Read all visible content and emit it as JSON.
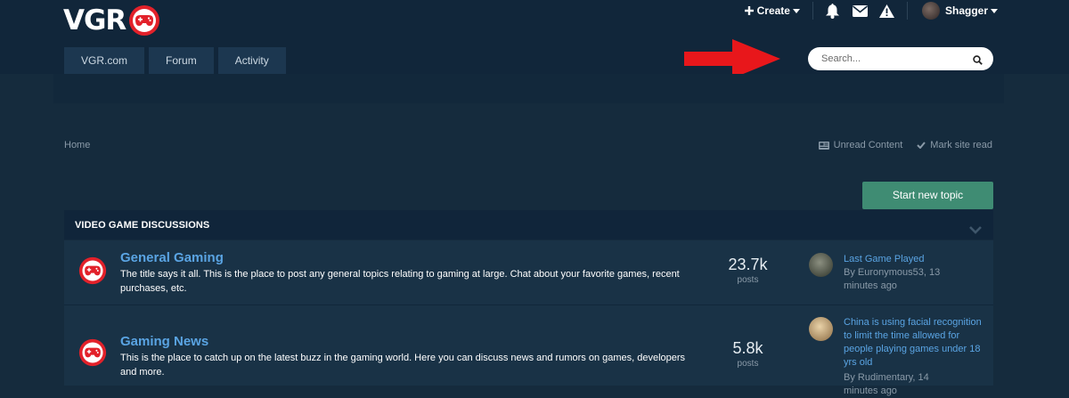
{
  "site": {
    "logo_text": "VGR"
  },
  "userbar": {
    "create_label": "Create",
    "username": "Shagger"
  },
  "nav": {
    "tabs": [
      {
        "label": "VGR.com"
      },
      {
        "label": "Forum"
      },
      {
        "label": "Activity"
      }
    ]
  },
  "search": {
    "placeholder": "Search..."
  },
  "breadcrumb": {
    "home": "Home"
  },
  "actions": {
    "unread_label": "Unread Content",
    "mark_read_label": "Mark site read"
  },
  "start_topic_label": "Start new topic",
  "category": {
    "title": "VIDEO GAME DISCUSSIONS",
    "forums": [
      {
        "title": "General Gaming",
        "description": "The title says it all. This is the place to post any general topics relating to gaming at large. Chat about your favorite games, recent purchases, etc.",
        "posts_count": "23.7k",
        "posts_label": "posts",
        "last_post": {
          "title": "Last Game Played",
          "meta": "By Euronymous53, 13 minutes ago"
        }
      },
      {
        "title": "Gaming News",
        "description": "This is the place to catch up on the latest buzz in the gaming world. Here you can discuss news and rumors on games, developers and more.",
        "posts_count": "5.8k",
        "posts_label": "posts",
        "last_post": {
          "title": "China is using facial recognition to limit the time allowed for people playing games under 18 yrs old",
          "meta": "By Rudimentary, 14 minutes ago"
        }
      }
    ]
  },
  "colors": {
    "page_bg": "#152b3d",
    "header_bg": "#11263a",
    "accent_link": "#5aa4e3",
    "start_button": "#3f8c73",
    "annotation_arrow": "#e8171b"
  },
  "icons": {
    "logo_mark": "gamepad-logo-icon",
    "create": "plus-icon",
    "notifications": "bell-icon",
    "messages": "envelope-icon",
    "reports": "warning-icon",
    "search": "search-icon",
    "unread": "newspaper-icon",
    "mark_read": "checkmark-icon",
    "collapse": "chevron-down-icon",
    "forum": "forum-logo-icon"
  }
}
